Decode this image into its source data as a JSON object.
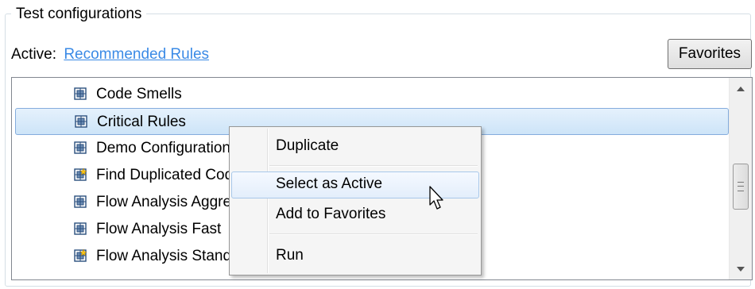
{
  "group": {
    "title": "Test configurations"
  },
  "active": {
    "label": "Active:",
    "link": "Recommended Rules"
  },
  "favorites_button": "Favorites",
  "configurations": [
    {
      "name": "Code Smells",
      "icon": "config-icon",
      "selected": false
    },
    {
      "name": "Critical Rules",
      "icon": "config-icon",
      "selected": true
    },
    {
      "name": "Demo Configuration",
      "icon": "config-icon",
      "selected": false
    },
    {
      "name": "Find Duplicated Code",
      "icon": "favorite-config-icon",
      "selected": false
    },
    {
      "name": "Flow Analysis Aggressive",
      "icon": "config-icon",
      "selected": false
    },
    {
      "name": "Flow Analysis Fast",
      "icon": "config-icon",
      "selected": false
    },
    {
      "name": "Flow Analysis Standard",
      "icon": "favorite-config-icon",
      "selected": false
    }
  ],
  "context_menu": {
    "items": [
      "Duplicate",
      "Select as Active",
      "Add to Favorites",
      "Run"
    ],
    "hovered": "Select as Active"
  },
  "colors": {
    "link": "#3a8ae6",
    "selection_border": "#84acdd",
    "menu_bg": "#f5f5f5"
  }
}
